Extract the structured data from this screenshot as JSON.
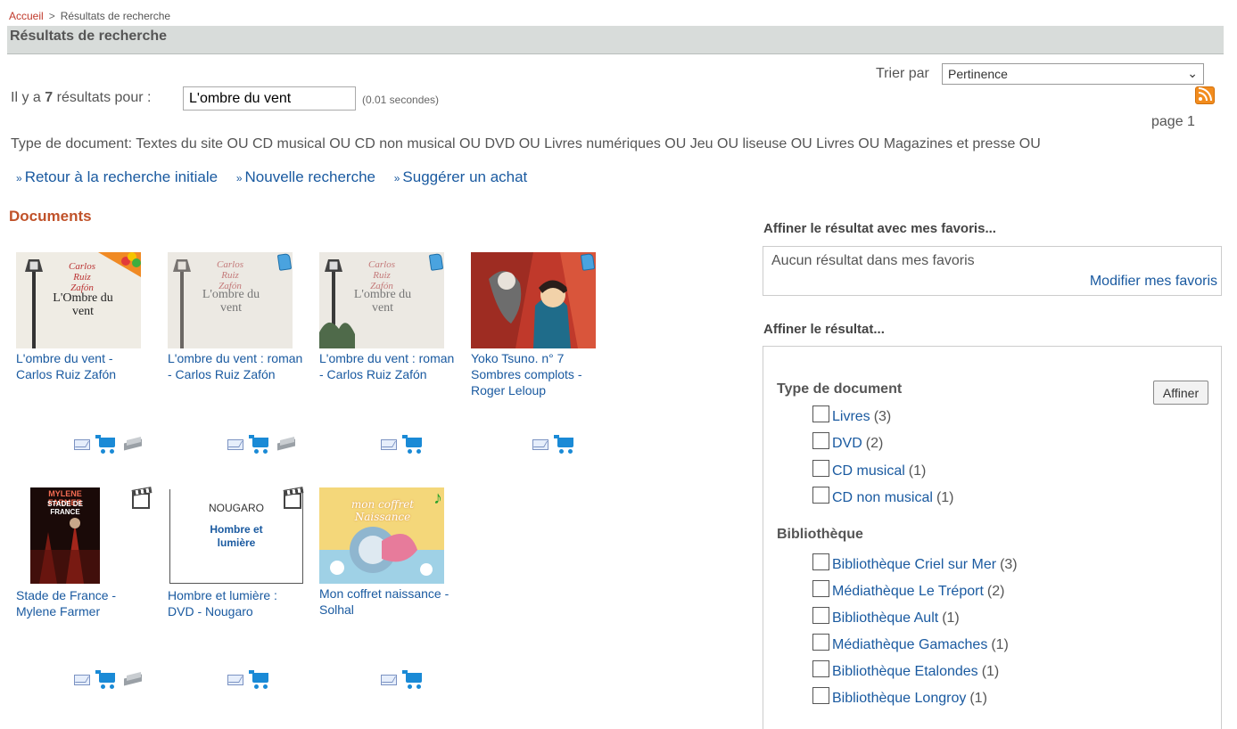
{
  "breadcrumb": {
    "home": "Accueil",
    "separator": ">",
    "current": "Résultats de recherche"
  },
  "page_title": "Résultats de recherche",
  "sort": {
    "label": "Trier par",
    "value": "Pertinence"
  },
  "results": {
    "prefix": "Il y a",
    "count": "7",
    "suffix": "résultats pour :",
    "query": "L'ombre du vent",
    "elapsed": "(0.01 secondes)",
    "page": "page 1"
  },
  "filter_line": "Type de document: Textes du site OU CD musical OU CD non musical OU DVD OU Livres numériques OU Jeu OU liseuse OU Livres OU Magazines et presse OU",
  "actions": {
    "back": "Retour à la recherche initiale",
    "new_search": "Nouvelle recherche",
    "suggest": "Suggérer un achat"
  },
  "documents_heading": "Documents",
  "documents": [
    {
      "title": "L'ombre du vent - Carlos Ruiz Zafón",
      "badge": "multi-format-icon",
      "cover": {
        "author": "Carlos Ruiz Zafón",
        "title": "L'Ombre du vent"
      },
      "icons": [
        "mail-icon",
        "cart-icon",
        "book-icon"
      ]
    },
    {
      "title": "L'ombre du vent : roman - Carlos Ruiz Zafón",
      "badge": "book-icon",
      "cover": {
        "author": "Carlos Ruiz Zafón",
        "title": "L'ombre du vent"
      },
      "icons": [
        "mail-icon",
        "cart-icon",
        "book-icon"
      ]
    },
    {
      "title": "L'ombre du vent : roman - Carlos Ruiz Zafón",
      "badge": "book-icon",
      "cover": {
        "author": "Carlos Ruiz Zafón",
        "title": "L'ombre du vent"
      },
      "icons": [
        "mail-icon",
        "cart-icon"
      ]
    },
    {
      "title": "Yoko Tsuno. n° 7 Sombres complots - Roger Leloup",
      "badge": "book-icon",
      "cover": {},
      "icons": [
        "mail-icon",
        "cart-icon"
      ]
    },
    {
      "title": "Stade de France - Mylene Farmer",
      "badge": "film-icon",
      "cover": {
        "artist": "MYLENE FARMER",
        "title": "STADE DE FRANCE"
      },
      "icons": [
        "mail-icon",
        "cart-icon",
        "book-icon"
      ]
    },
    {
      "title": "Hombre et lumière : DVD - Nougaro",
      "badge": "film-icon",
      "cover": {
        "artist": "NOUGARO",
        "title": "Hombre et lumière"
      },
      "icons": [
        "mail-icon",
        "cart-icon"
      ]
    },
    {
      "title": "Mon coffret naissance - Solhal",
      "badge": "music-note-icon",
      "cover": {
        "title": "mon coffret Naissance"
      },
      "icons": [
        "mail-icon",
        "cart-icon"
      ]
    }
  ],
  "favorites": {
    "heading": "Affiner le résultat avec mes favoris...",
    "empty": "Aucun résultat dans mes favoris",
    "modify": "Modifier mes favoris"
  },
  "refine": {
    "heading": "Affiner le résultat...",
    "button": "Affiner",
    "groups": [
      {
        "title": "Type de document",
        "items": [
          {
            "label": "Livres",
            "count": "(3)"
          },
          {
            "label": "DVD",
            "count": "(2)"
          },
          {
            "label": "CD musical",
            "count": "(1)"
          },
          {
            "label": "CD non musical",
            "count": "(1)"
          }
        ]
      },
      {
        "title": "Bibliothèque",
        "items": [
          {
            "label": "Bibliothèque Criel sur Mer",
            "count": "(3)"
          },
          {
            "label": "Médiathèque Le Tréport",
            "count": "(2)"
          },
          {
            "label": "Bibliothèque Ault",
            "count": "(1)"
          },
          {
            "label": "Médiathèque Gamaches",
            "count": "(1)"
          },
          {
            "label": "Bibliothèque Etalondes",
            "count": "(1)"
          },
          {
            "label": "Bibliothèque Longroy",
            "count": "(1)"
          }
        ]
      }
    ]
  },
  "colors": {
    "link": "#1a5aa0",
    "heading_accent": "#c0522a",
    "title_bar": "#d8dcda",
    "rss": "#f28c1e"
  }
}
